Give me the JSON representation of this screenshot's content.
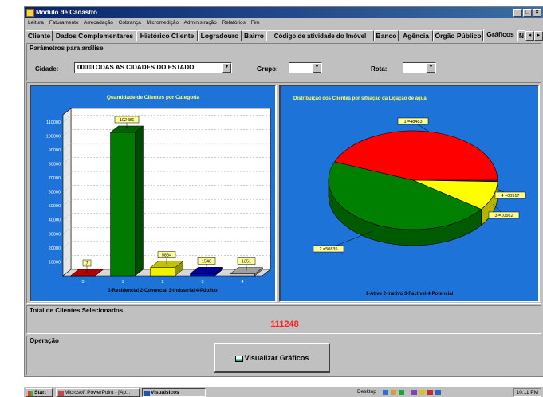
{
  "window": {
    "title": "Módulo de Cadastro",
    "controls": [
      "_",
      "□",
      "×"
    ]
  },
  "menu": [
    "Leitura",
    "Faturamento",
    "Arrecadação",
    "Cobrança",
    "Micromedição",
    "Administração",
    "Relatórios",
    "Fim"
  ],
  "tabs": [
    {
      "label": "Cliente"
    },
    {
      "label": "Dados Complementares"
    },
    {
      "label": "Histórico Cliente"
    },
    {
      "label": "Logradouro"
    },
    {
      "label": "Bairro"
    },
    {
      "label": "Código de  atividade do Imóvel"
    },
    {
      "label": "Banco"
    },
    {
      "label": "Agência"
    },
    {
      "label": "Órgão Público"
    },
    {
      "label": "Gráficos",
      "active": true
    },
    {
      "label": "N"
    }
  ],
  "params": {
    "heading": "Parâmetros para análise",
    "cidade_label": "Cidade:",
    "cidade_value": "000=TODAS AS CIDADES DO ESTADO",
    "grupo_label": "Grupo:",
    "grupo_value": "",
    "rota_label": "Rota:",
    "rota_value": ""
  },
  "chart_data": [
    {
      "type": "bar",
      "title": "Quantidade de Clientes por Categoria",
      "categories": [
        "0",
        "1",
        "2",
        "3",
        "4"
      ],
      "values": [
        7,
        102486,
        5864,
        1540,
        1351
      ],
      "bar_colors": [
        "#e00000",
        "#007a00",
        "#f2f200",
        "#0000c0",
        "#c8c8c8"
      ],
      "yticks": [
        10000,
        20000,
        30000,
        40000,
        50000,
        60000,
        70000,
        80000,
        90000,
        100000,
        110000
      ],
      "ylim": [
        0,
        115000
      ],
      "xlabel": "1-Residencial 2-Comercial 3-Industrial 4-Público",
      "grid": true
    },
    {
      "type": "pie",
      "title": "Distribuição dos  Clientes por situação da Ligação de água",
      "slices": [
        {
          "label": "1 =48483",
          "value": 48483,
          "color": "#ff0000"
        },
        {
          "label": "2 =50835",
          "value": 50835,
          "color": "#008000"
        },
        {
          "label": "3 =10562",
          "value": 10562,
          "color": "#ffff00"
        },
        {
          "label": "4 =00517",
          "value": 517,
          "color": "#3a3a8a"
        }
      ],
      "legend_text": "1-Ativo 2-Inativo 3-Factível 4-Potencial"
    }
  ],
  "total": {
    "heading": "Total de Clientes Selecionados",
    "value": "111248",
    "color": "#ff2020"
  },
  "operacao": {
    "heading": "Operação",
    "button_label": "Visualizar Gráficos"
  },
  "taskbar": {
    "start_label": "Start",
    "items": [
      "Microsoft PowerPoint - [Ap...",
      "Visualsicos"
    ],
    "desktop_label": "Desktop",
    "clock": "10:11 PM"
  }
}
